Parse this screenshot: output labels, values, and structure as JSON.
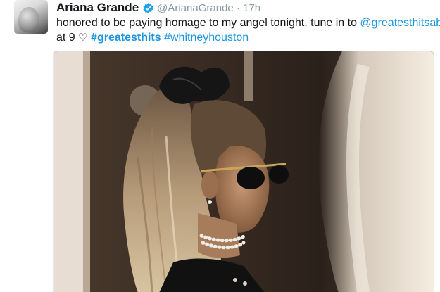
{
  "tweet": {
    "author_name": "Ariana Grande",
    "handle": "@ArianaGrande",
    "separator": "·",
    "timestamp": "17h",
    "verified": true,
    "text_part1": "honored to be paying homage to my angel tonight. tune in to ",
    "mention": "@greatesthitsabc",
    "text_part2": "at 9 ",
    "heart": "♡",
    "hashtag1": "#greatesthits",
    "hashtag2": "#whitneyhouston"
  },
  "colors": {
    "link": "#1b95e0",
    "verified_badge": "#1da1f2",
    "meta_gray": "#8899a6"
  },
  "icons": {
    "verified": "verified-badge-icon"
  }
}
